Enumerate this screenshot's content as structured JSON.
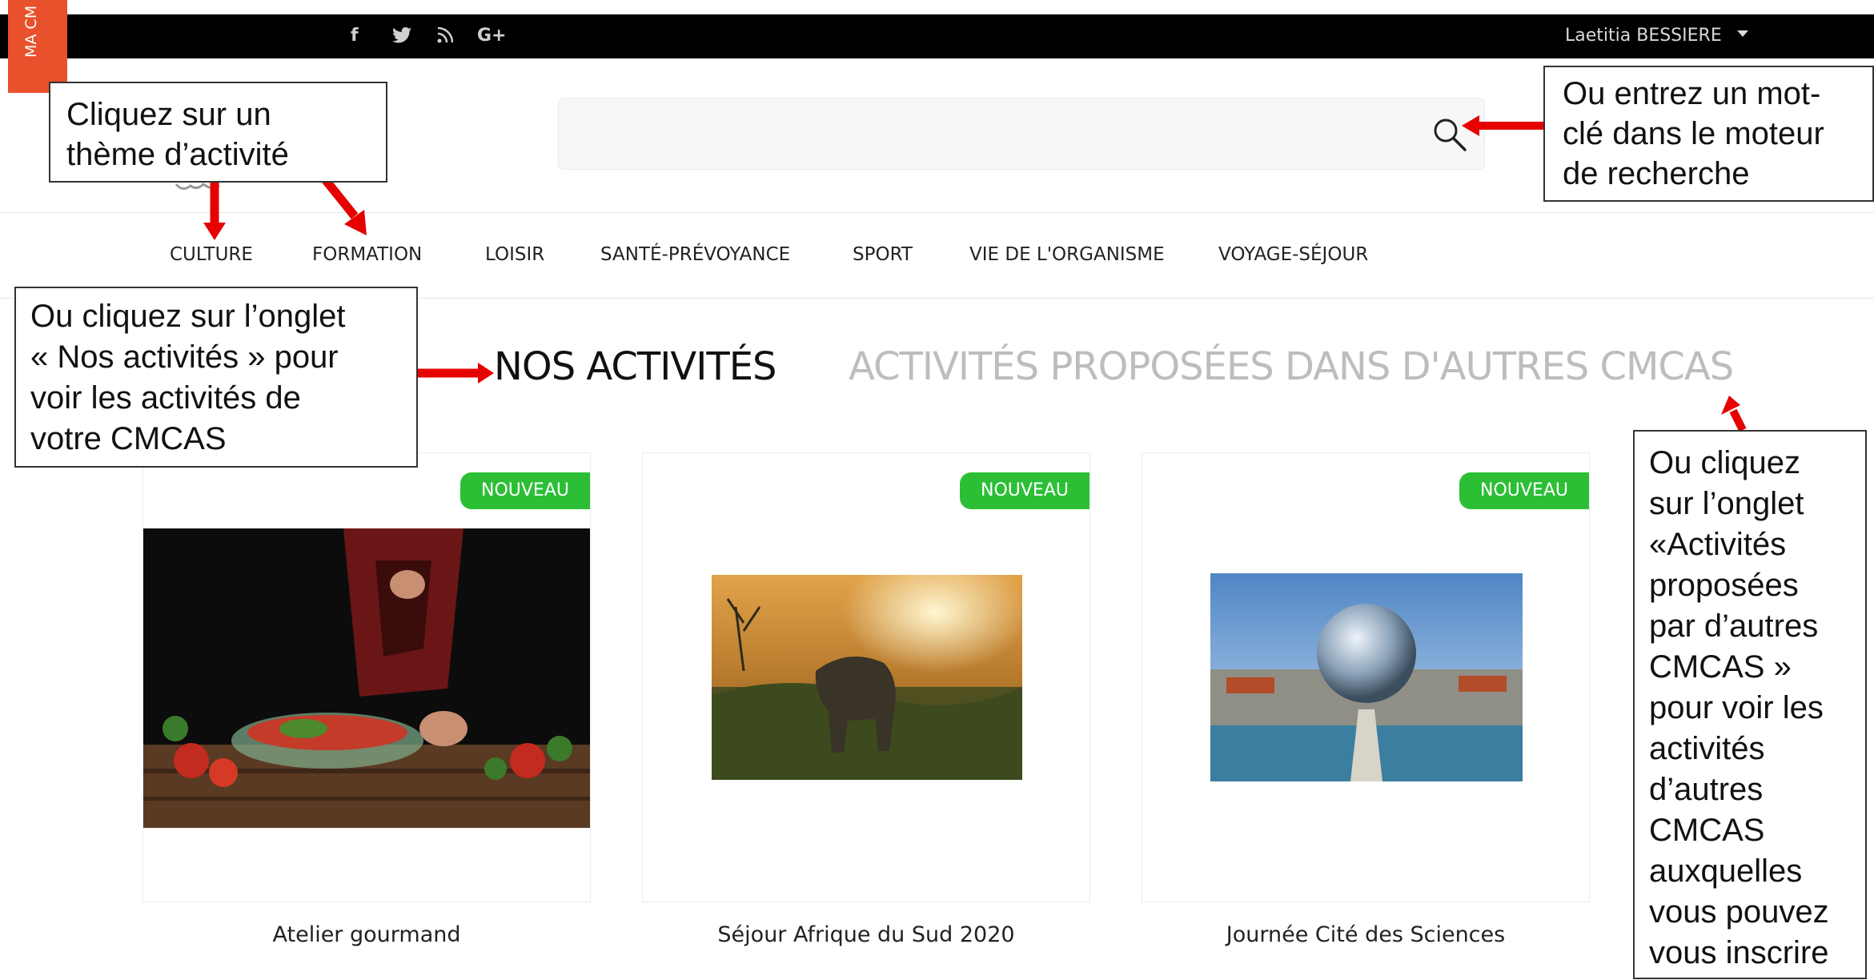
{
  "topbar": {
    "social_icons": [
      {
        "name": "facebook-icon",
        "glyph": "f"
      },
      {
        "name": "twitter-icon",
        "glyph": "🐦"
      },
      {
        "name": "rss-icon",
        "glyph": "ℜ"
      },
      {
        "name": "google-plus-icon",
        "glyph": "G+"
      }
    ],
    "user_name": "Laetitia BESSIERE"
  },
  "side_tab": {
    "label": "MA CM"
  },
  "search": {
    "placeholder": ""
  },
  "nav": {
    "items": [
      {
        "label": "CULTURE"
      },
      {
        "label": "FORMATION"
      },
      {
        "label": "LOISIR"
      },
      {
        "label": "SANTÉ-PRÉVOYANCE"
      },
      {
        "label": "SPORT"
      },
      {
        "label": "VIE DE L'ORGANISME"
      },
      {
        "label": "VOYAGE-SÉJOUR"
      }
    ]
  },
  "tabs": {
    "nos": "NOS ACTIVITÉS",
    "autres": "ACTIVITÉS PROPOSÉES DANS D'AUTRES CMCAS"
  },
  "cards": [
    {
      "badge": "NOUVEAU",
      "title": "Atelier gourmand"
    },
    {
      "badge": "NOUVEAU",
      "title": "Séjour Afrique du Sud 2020"
    },
    {
      "badge": "NOUVEAU",
      "title": "Journée Cité des Sciences"
    }
  ],
  "annotations": {
    "theme": "Cliquez sur un\nthème d’activité",
    "search": "Ou entrez un mot-\nclé dans le moteur\nde recherche",
    "nos": "Ou cliquez sur l’onglet\n« Nos activités » pour\nvoir les activités de\nvotre CMCAS",
    "autres": "Ou cliquez\nsur l’onglet\n«Activités\nproposées\npar d’autres\nCMCAS »\npour voir les\nactivités\nd’autres\nCMCAS\nauxquelles\nvous pouvez\nvous inscrire"
  },
  "colors": {
    "accent_orange": "#e8512b",
    "badge_green": "#2cbf36",
    "arrow_red": "#e60000",
    "topbar": "#000000"
  }
}
